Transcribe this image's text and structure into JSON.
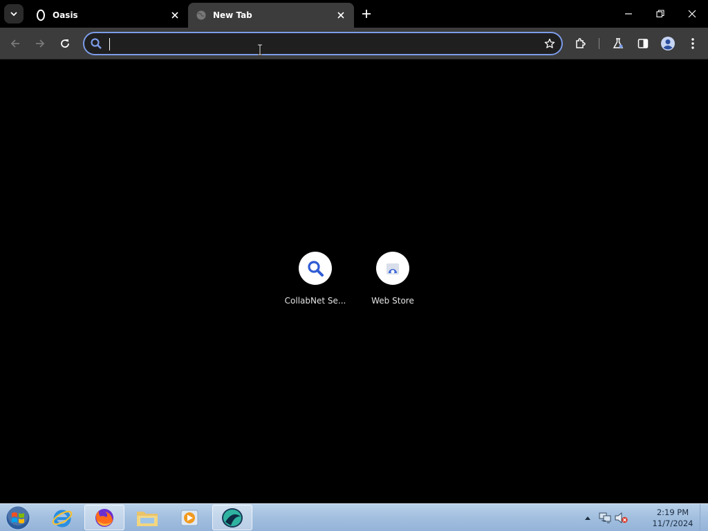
{
  "browser": {
    "tabs": [
      {
        "label": "Oasis",
        "favicon": "oasis-logo",
        "active": false
      },
      {
        "label": "New Tab",
        "favicon": "globe-icon",
        "active": true
      }
    ],
    "omnibox": {
      "value": "",
      "placeholder": ""
    },
    "accent_color": "#7c9ce8"
  },
  "new_tab_page": {
    "shortcuts": [
      {
        "label": "CollabNet Se...",
        "icon": "search-icon"
      },
      {
        "label": "Web Store",
        "icon": "web-store-icon"
      }
    ]
  },
  "taskbar": {
    "apps": [
      "internet-explorer",
      "firefox",
      "file-explorer",
      "media-player",
      "browser"
    ],
    "clock": {
      "time": "2:19 PM",
      "date": "11/7/2024"
    }
  }
}
